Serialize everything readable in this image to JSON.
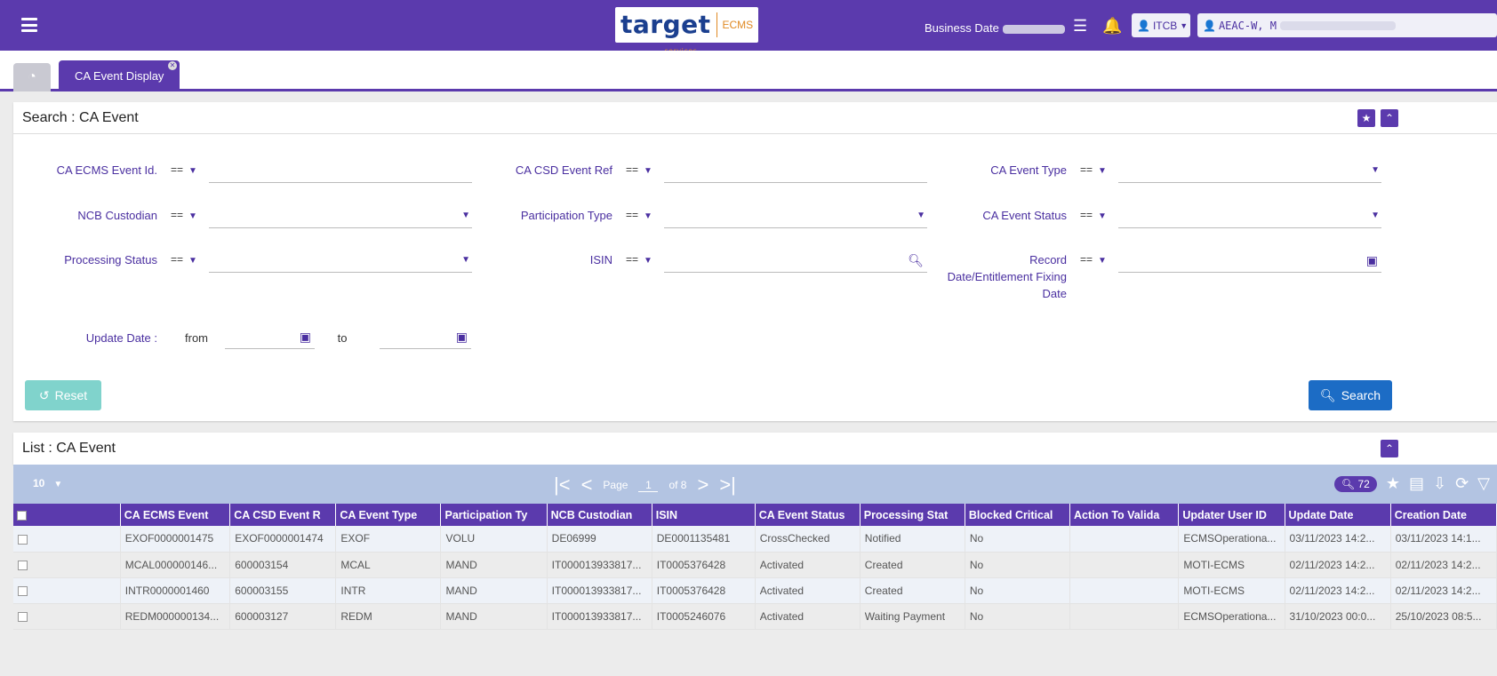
{
  "header": {
    "logo_text": "target",
    "logo_sub": "services",
    "logo_product": "ECMS",
    "business_date_label": "Business Date",
    "bank_button": "ITCB",
    "user_button": "AEAC-W, M"
  },
  "tabs": {
    "active_label": "CA Event Display"
  },
  "search": {
    "title": "Search : CA Event",
    "op_value": "==",
    "fields": {
      "ecms_event_id": "CA ECMS Event Id.",
      "csd_event_ref": "CA CSD Event Ref",
      "event_type": "CA Event Type",
      "ncb_custodian": "NCB Custodian",
      "participation_type": "Participation Type",
      "event_status": "CA Event Status",
      "processing_status": "Processing Status",
      "isin": "ISIN",
      "record_date": "Record Date/Entitlement Fixing Date",
      "update_date": "Update Date :",
      "from": "from",
      "to": "to"
    },
    "reset_label": "Reset",
    "search_label": "Search"
  },
  "list": {
    "title": "List : CA Event",
    "page_size": "10",
    "page_label": "Page",
    "page_current": "1",
    "page_of": "of 8",
    "result_count": "72",
    "columns": [
      "CA ECMS Event",
      "CA CSD Event R",
      "CA Event Type",
      "Participation Ty",
      "NCB Custodian",
      "ISIN",
      "CA Event Status",
      "Processing Stat",
      "Blocked Critical",
      "Action To Valida",
      "Updater User ID",
      "Update Date",
      "Creation Date"
    ],
    "rows": [
      [
        "EXOF0000001475",
        "EXOF0000001474",
        "EXOF",
        "VOLU",
        "DE06999",
        "DE0001135481",
        "CrossChecked",
        "Notified",
        "No",
        "",
        "ECMSOperationa...",
        "03/11/2023 14:2...",
        "03/11/2023 14:1..."
      ],
      [
        "MCAL000000146...",
        "600003154",
        "MCAL",
        "MAND",
        "IT000013933817...",
        "IT0005376428",
        "Activated",
        "Created",
        "No",
        "",
        "MOTI-ECMS",
        "02/11/2023 14:2...",
        "02/11/2023 14:2..."
      ],
      [
        "INTR0000001460",
        "600003155",
        "INTR",
        "MAND",
        "IT000013933817...",
        "IT0005376428",
        "Activated",
        "Created",
        "No",
        "",
        "MOTI-ECMS",
        "02/11/2023 14:2...",
        "02/11/2023 14:2..."
      ],
      [
        "REDM000000134...",
        "600003127",
        "REDM",
        "MAND",
        "IT000013933817...",
        "IT0005246076",
        "Activated",
        "Waiting Payment",
        "No",
        "",
        "ECMSOperationa...",
        "31/10/2023 00:0...",
        "25/10/2023 08:5..."
      ]
    ]
  }
}
